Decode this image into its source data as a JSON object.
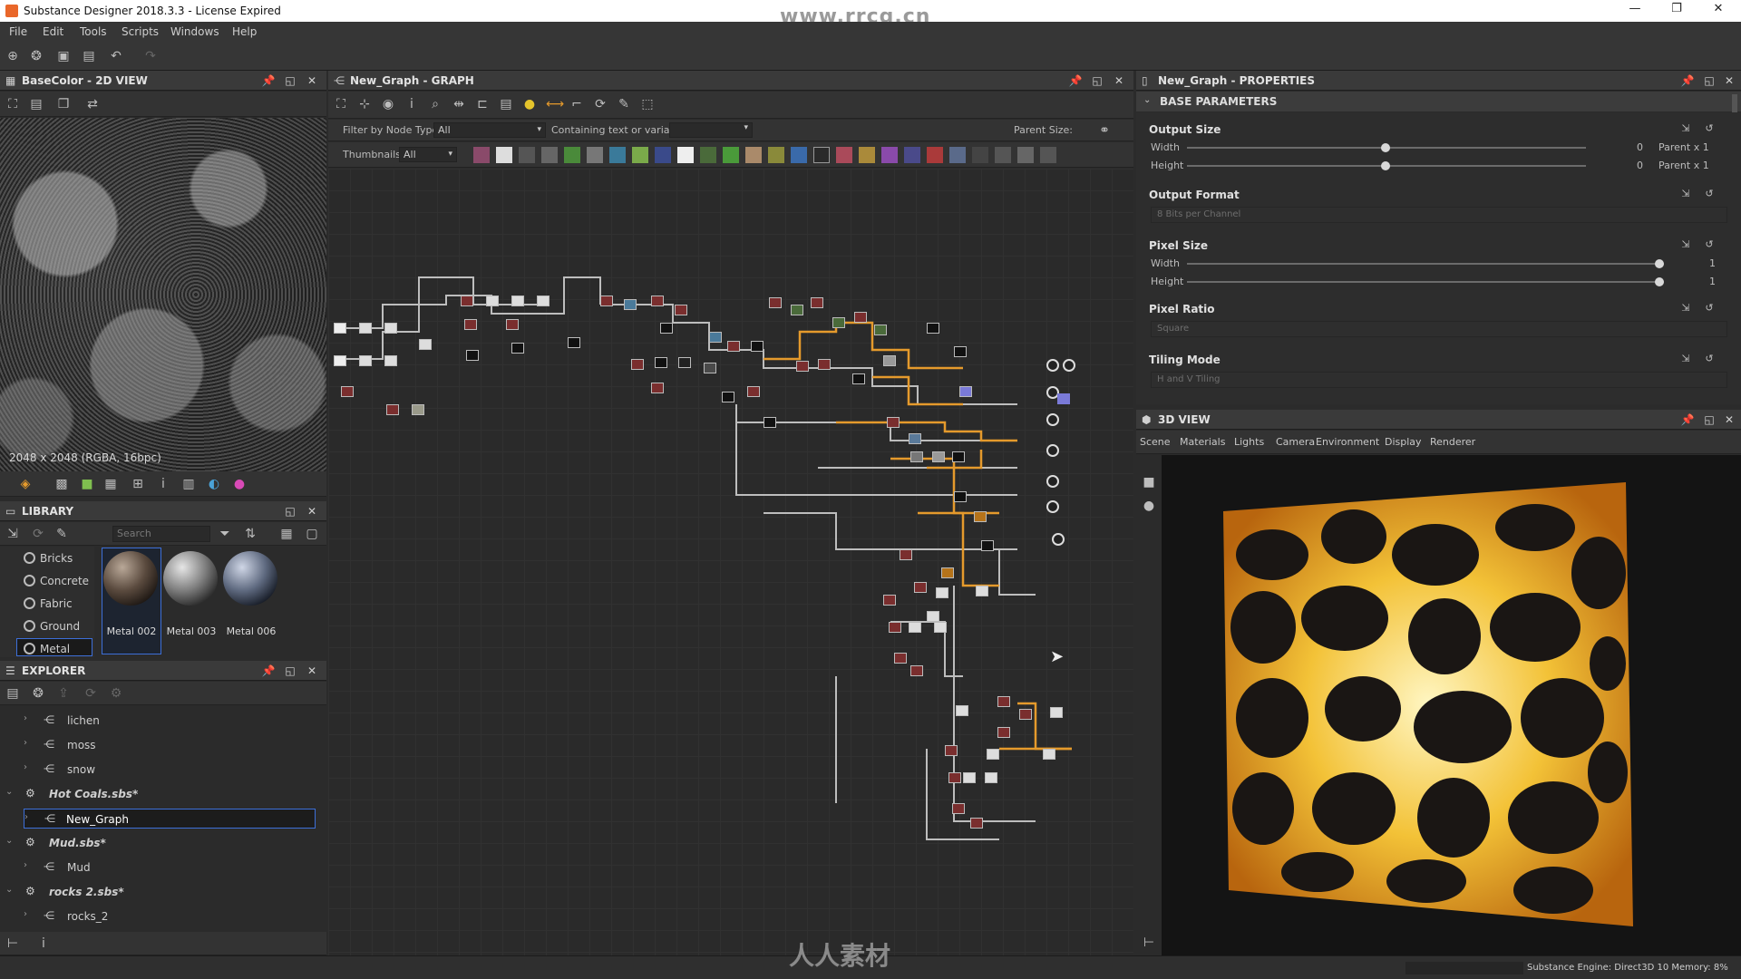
{
  "window": {
    "title": "Substance Designer 2018.3.3 - License Expired",
    "controls": {
      "minimize": "—",
      "maximize": "❐",
      "close": "✕"
    }
  },
  "menu": [
    "File",
    "Edit",
    "Tools",
    "Scripts",
    "Windows",
    "Help"
  ],
  "watermark_top": "www.rrcg.cn",
  "watermark_bottom": "人人素材",
  "view2d": {
    "title": "BaseColor - 2D VIEW",
    "resolution": "2048 x 2048 (RGBA, 16bpc)"
  },
  "library": {
    "title": "LIBRARY",
    "search_placeholder": "Search",
    "categories": [
      "Bricks",
      "Concrete",
      "Fabric",
      "Ground",
      "Metal"
    ],
    "materials": [
      "Metal 002",
      "Metal 003",
      "Metal 006"
    ]
  },
  "explorer": {
    "title": "EXPLORER",
    "items": [
      {
        "label": "lichen"
      },
      {
        "label": "moss"
      },
      {
        "label": "snow"
      },
      {
        "label": "Hot Coals.sbs*"
      },
      {
        "label": "New_Graph"
      },
      {
        "label": "Mud.sbs*"
      },
      {
        "label": "Mud"
      },
      {
        "label": "rocks 2.sbs*"
      },
      {
        "label": "rocks_2"
      }
    ]
  },
  "graph": {
    "title": "New_Graph - GRAPH",
    "filter_label": "Filter by Node Type",
    "filter_value": "All",
    "containing_label": "Containing text or variable",
    "parent_size_label": "Parent Size:",
    "thumbnails_label": "Thumbnails:",
    "thumbnails_value": "All"
  },
  "properties": {
    "title": "New_Graph - PROPERTIES",
    "section": "BASE PARAMETERS",
    "output_size": {
      "label": "Output Size",
      "width_label": "Width",
      "height_label": "Height",
      "width_value": "0",
      "height_value": "0",
      "width_rel": "Parent x 1",
      "height_rel": "Parent x 1"
    },
    "output_format": {
      "label": "Output Format",
      "value": "8 Bits per Channel"
    },
    "pixel_size": {
      "label": "Pixel Size",
      "width_label": "Width",
      "height_label": "Height",
      "width_value": "1",
      "height_value": "1"
    },
    "pixel_ratio": {
      "label": "Pixel Ratio",
      "value": "Square"
    },
    "tiling_mode": {
      "label": "Tiling Mode",
      "value": "H and V Tiling"
    }
  },
  "view3d": {
    "title": "3D VIEW",
    "menu": [
      "Scene",
      "Materials",
      "Lights",
      "Camera",
      "Environment",
      "Display",
      "Renderer"
    ]
  },
  "status": {
    "engine": "Substance Engine: Direct3D 10  Memory: 8%"
  },
  "colors": {
    "accent_orange": "#e59a2c",
    "wire": "#bdbdbd",
    "selection": "#3d6fd8"
  }
}
